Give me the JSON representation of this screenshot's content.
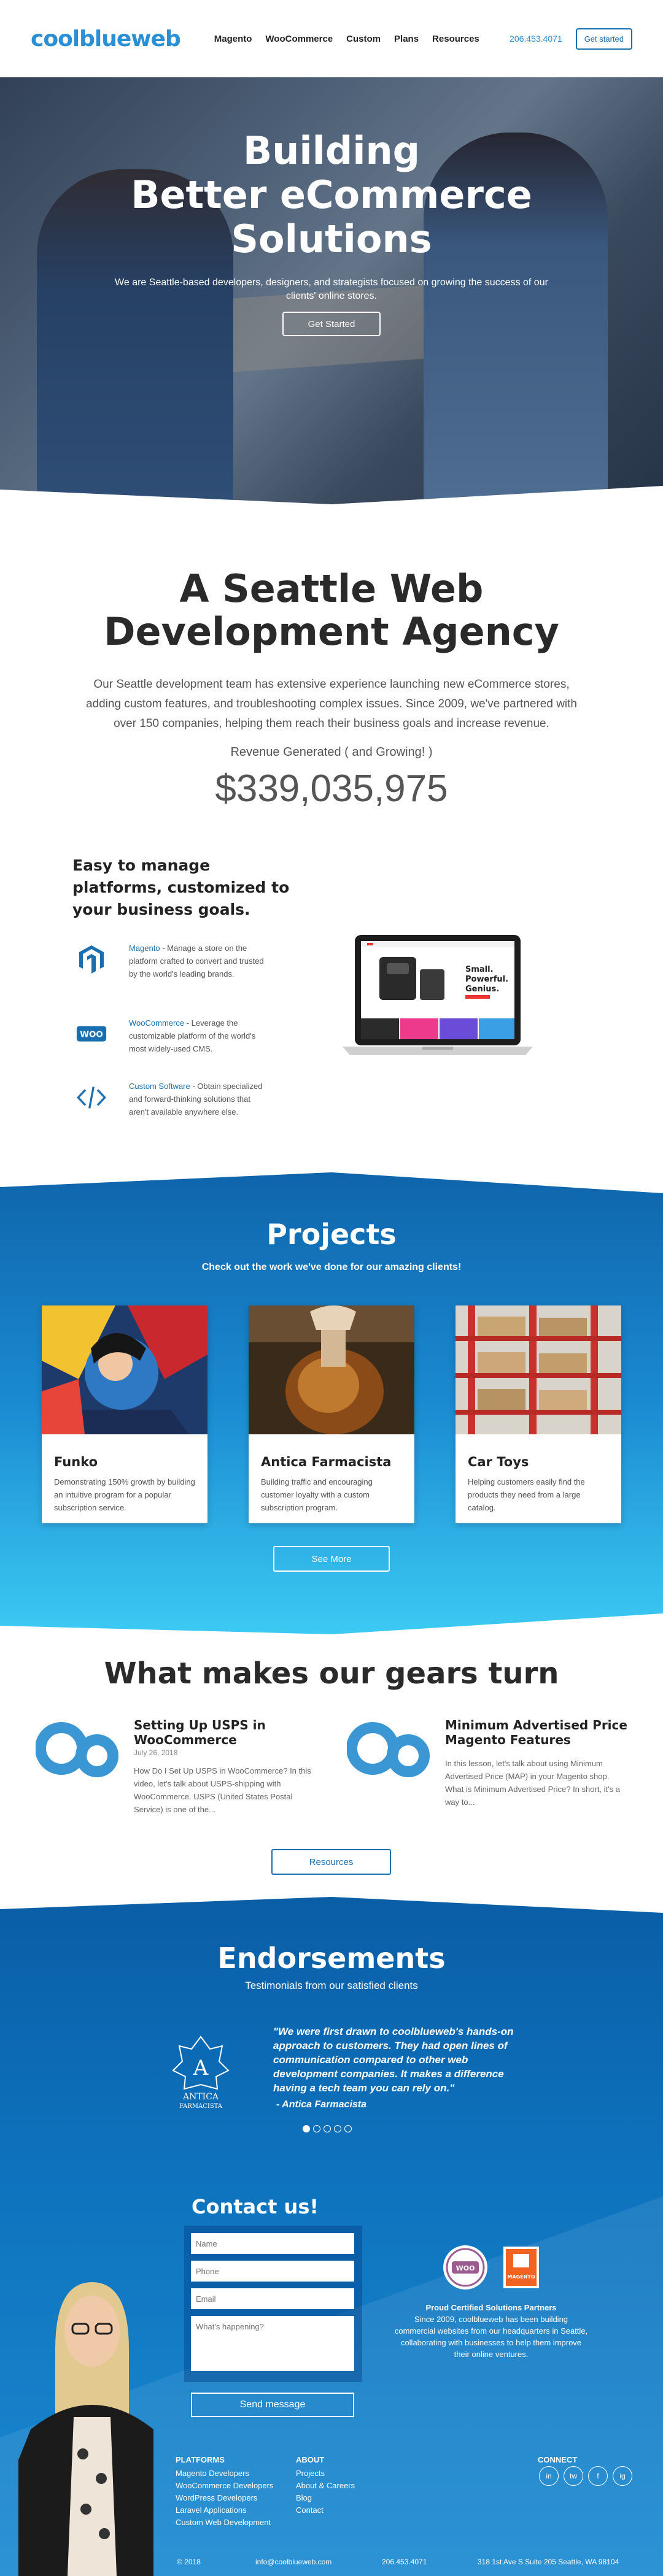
{
  "header": {
    "logo": "coolblueweb",
    "nav": [
      "Magento",
      "WooCommerce",
      "Custom",
      "Plans",
      "Resources"
    ],
    "phone": "206.453.4071",
    "cta": "Get started"
  },
  "hero": {
    "title": "Building\nBetter eCommerce\nSolutions",
    "subtitle": "We are Seattle-based developers, designers, and strategists focused on growing the success of our clients' online stores.",
    "button": "Get Started"
  },
  "agency": {
    "title": "A Seattle Web\nDevelopment Agency",
    "text": "Our Seattle development team has extensive experience launching new eCommerce stores, adding custom features, and troubleshooting complex issues. Since 2009, we've partnered with over 150 companies, helping them reach their business goals and increase revenue.",
    "revenue_label": "Revenue Generated ( and Growing! )",
    "revenue_value": "$339,035,975"
  },
  "platforms": {
    "title": "Easy to manage platforms, customized to your business goals.",
    "items": [
      {
        "name": "Magento",
        "text": " - Manage a store on the platform crafted to convert and trusted by the world's leading brands.",
        "icon": "magento-icon"
      },
      {
        "name": "WooCommerce",
        "text": " - Leverage the customizable platform of the world's most widely-used CMS.",
        "icon": "woo-icon"
      },
      {
        "name": "Custom Software",
        "text": " - Obtain specialized and forward-thinking solutions that aren't available anywhere else.",
        "icon": "code-icon"
      }
    ],
    "laptop_text": "Small.\nPowerful.\nGenius."
  },
  "projects": {
    "title": "Projects",
    "subtitle": "Check out the work we've done for our amazing clients!",
    "cards": [
      {
        "name": "Funko",
        "text": "Demonstrating 150% growth by building an intuitive program for a popular subscription service."
      },
      {
        "name": "Antica Farmacista",
        "text": "Building traffic and encouraging customer loyalty with a custom subscription program."
      },
      {
        "name": "Car Toys",
        "text": "Helping customers easily find the products they need from a large catalog."
      }
    ],
    "button": "See More"
  },
  "gears": {
    "title": "What makes our gears turn",
    "posts": [
      {
        "title": "Setting Up USPS in WooCommerce",
        "date": "July 26, 2018",
        "excerpt": "How Do I Set Up USPS in WooCommerce? In this video, let's talk about USPS-shipping with WooCommerce. USPS (United States Postal Service) is one of the..."
      },
      {
        "title": "Minimum Advertised Price Magento Features",
        "date": "",
        "excerpt": "In this lesson, let's talk about using Minimum Advertised Price (MAP) in your Magento shop. What is Minimum Advertised Price? In short, it's a way to..."
      }
    ],
    "button": "Resources"
  },
  "endorsements": {
    "title": "Endorsements",
    "subtitle": "Testimonials from our satisfied clients",
    "logo_text": "ANTICA\nFARMACISTA",
    "quote": "\"We were first drawn to coolblueweb's hands-on approach to customers. They had open lines of communication compared to other web development companies. It makes a difference having a tech team you can rely on.\"",
    "author": "- Antica Farmacista",
    "slides": 5,
    "active_slide": 0
  },
  "contact": {
    "title": "Contact us!",
    "name_ph": "Name",
    "phone_ph": "Phone",
    "email_ph": "Email",
    "msg_ph": "What's happening?",
    "send": "Send message",
    "partner_title": "Proud Certified Solutions Partners",
    "partner_text": "Since 2009, coolblueweb has been building commercial websites from our headquarters in Seattle, collaborating with businesses to help them improve their online ventures.",
    "badge_woo": "WOO",
    "badge_mag": "MAGENTO"
  },
  "footer": {
    "platforms_title": "PLATFORMS",
    "platforms": [
      "Magento Developers",
      "WooCommerce Developers",
      "WordPress Developers",
      "Laravel Applications",
      "Custom Web Development"
    ],
    "about_title": "ABOUT",
    "about": [
      "Projects",
      "About & Careers",
      "Blog",
      "Contact"
    ],
    "connect_title": "CONNECT",
    "social": [
      "in",
      "tw",
      "f",
      "ig"
    ],
    "copyright": "© 2018",
    "email": "info@coolblueweb.com",
    "phone": "206.453.4071",
    "address": "318 1st Ave S Suite 205 Seattle, WA 98104"
  },
  "colors": {
    "brand": "#2a8fd4",
    "dark_blue": "#0a5ea6",
    "light_blue": "#3ccaf3"
  }
}
